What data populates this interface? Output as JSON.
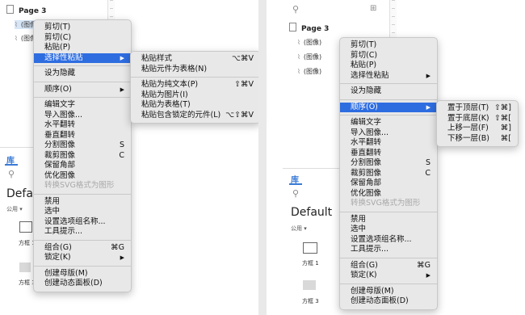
{
  "left": {
    "page": "Page 3",
    "image_label": "(图像)",
    "tab": "库",
    "library_name": "Default",
    "public": "公用 ▾",
    "frame1": "方框 1",
    "frame3": "方框 3",
    "context_menu": {
      "cut": "剪切(T)",
      "copy": "剪切(C)",
      "paste": "粘贴(P)",
      "paste_special": "选择性粘贴",
      "hide": "设为隐藏",
      "order": "顺序(O)",
      "edit_text": "编辑文字",
      "import_image": "导入图像...",
      "flip_h": "水平翻转",
      "flip_v": "垂直翻转",
      "split": "分割图像",
      "split_sc": "S",
      "crop": "裁剪图像",
      "crop_sc": "C",
      "keep_corners": "保留角部",
      "optimize": "优化图像",
      "svg_convert": "转换SVG格式为图形",
      "disable": "禁用",
      "select": "选中",
      "set_group_name": "设置选项组名称...",
      "tooltip": "工具提示...",
      "group": "组合(G)",
      "group_sc": "⌘G",
      "lock": "锁定(K)",
      "create_master": "创建母版(M)",
      "create_dynamic_panel": "创建动态面板(D)"
    },
    "submenu": {
      "paste_style": "粘贴样式",
      "paste_style_sc": "⌥⌘V",
      "paste_as_table_elem": "粘贴元件为表格(N)",
      "paste_plain": "粘贴为纯文本(P)",
      "paste_plain_sc": "⇧⌘V",
      "paste_image": "粘贴为图片(I)",
      "paste_table": "粘贴为表格(T)",
      "paste_locked": "粘贴包含锁定的元件(L)",
      "paste_locked_sc": "⌥⇧⌘V"
    }
  },
  "right": {
    "page": "Page 3",
    "image_label": "(图像)",
    "tab": "库",
    "library_name": "Default",
    "public": "公用 ▾",
    "frame1": "方框 1",
    "frame3": "方框 3",
    "context_menu": {
      "cut": "剪切(T)",
      "copy": "剪切(C)",
      "paste": "粘贴(P)",
      "paste_special": "选择性粘贴",
      "hide": "设为隐藏",
      "order": "顺序(O)",
      "edit_text": "编辑文字",
      "import_image": "导入图像...",
      "flip_h": "水平翻转",
      "flip_v": "垂直翻转",
      "split": "分割图像",
      "split_sc": "S",
      "crop": "裁剪图像",
      "crop_sc": "C",
      "keep_corners": "保留角部",
      "optimize": "优化图像",
      "svg_convert": "转换SVG格式为图形",
      "disable": "禁用",
      "select": "选中",
      "set_group_name": "设置选项组名称...",
      "tooltip": "工具提示...",
      "group": "组合(G)",
      "group_sc": "⌘G",
      "lock": "锁定(K)",
      "create_master": "创建母版(M)",
      "create_dynamic_panel": "创建动态面板(D)"
    },
    "submenu": {
      "bring_front": "置于顶层(T)",
      "bring_front_sc": "⇧⌘]",
      "send_back": "置于底层(K)",
      "send_back_sc": "⇧⌘[",
      "forward": "上移一层(F)",
      "forward_sc": "⌘]",
      "backward": "下移一层(B)",
      "backward_sc": "⌘["
    }
  }
}
